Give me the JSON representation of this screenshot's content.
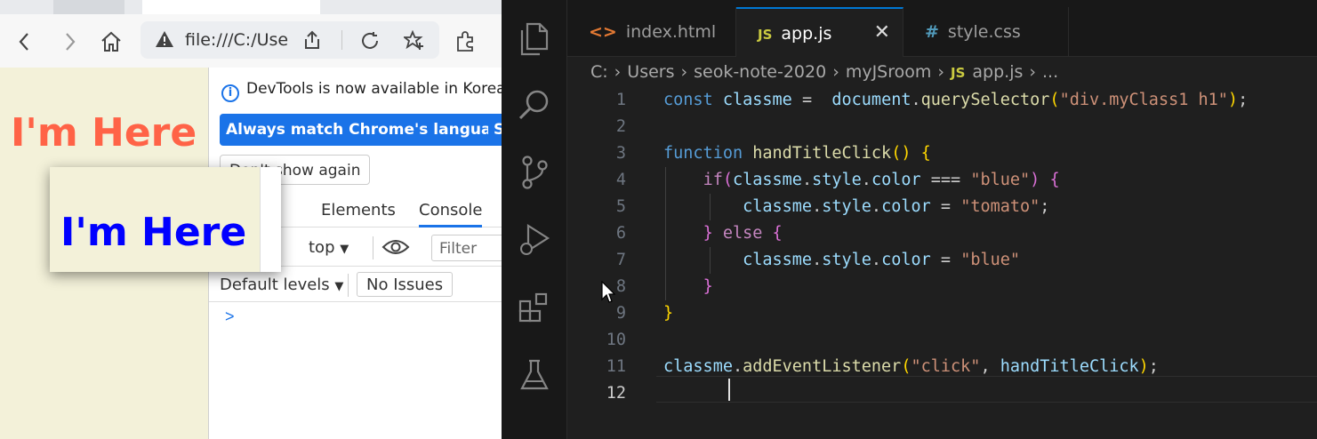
{
  "browser": {
    "address_url": "file:///C:/Use",
    "page_heading": "I'm Here",
    "page_heading_color": "#ff6347",
    "popup_heading": "I'm Here",
    "popup_heading_color": "#0000ff",
    "devtools": {
      "info_text": "DevTools is now available in Korea",
      "btn_match_language": "Always match Chrome's language",
      "btn_switch_partial": "S",
      "btn_dont_show": "Don't show again",
      "tabs": [
        "Elements",
        "Console"
      ],
      "context": "top",
      "filter_placeholder": "Filter",
      "levels": "Default levels",
      "issues": "No Issues",
      "prompt": ">"
    }
  },
  "editor": {
    "tabs": [
      {
        "icon": "<>",
        "label": "index.html"
      },
      {
        "icon": "JS",
        "label": "app.js",
        "close": "✕"
      },
      {
        "icon": "#",
        "label": "style.css"
      }
    ],
    "breadcrumb": [
      "C:",
      "Users",
      "seok-note-2020",
      "myJSroom",
      "app.js",
      "..."
    ],
    "breadcrumb_js_icon": "JS",
    "line_numbers": [
      "1",
      "2",
      "3",
      "4",
      "5",
      "6",
      "7",
      "8",
      "9",
      "10",
      "11",
      "12"
    ],
    "code": {
      "l1_const": "const",
      "l1_var": "classme",
      "l1_eq": " =  ",
      "l1_obj": "document",
      "l1_dot": ".",
      "l1_fn": "querySelector",
      "l1_str": "\"div.myClass1 h1\"",
      "l3_kw": "function",
      "l3_fn": "handTitleClick",
      "l4_if": "if",
      "l4_cond_a": "classme",
      "l4_prop": "style",
      "l4_prop2": "color",
      "l4_op": " === ",
      "l4_str": "\"blue\"",
      "l5_str": "\"tomato\"",
      "l6_else": "else",
      "l7_str": "\"blue\"",
      "l11_fn": "addEventListener",
      "l11_str": "\"click\"",
      "l11_arg": "handTitleClick"
    }
  }
}
